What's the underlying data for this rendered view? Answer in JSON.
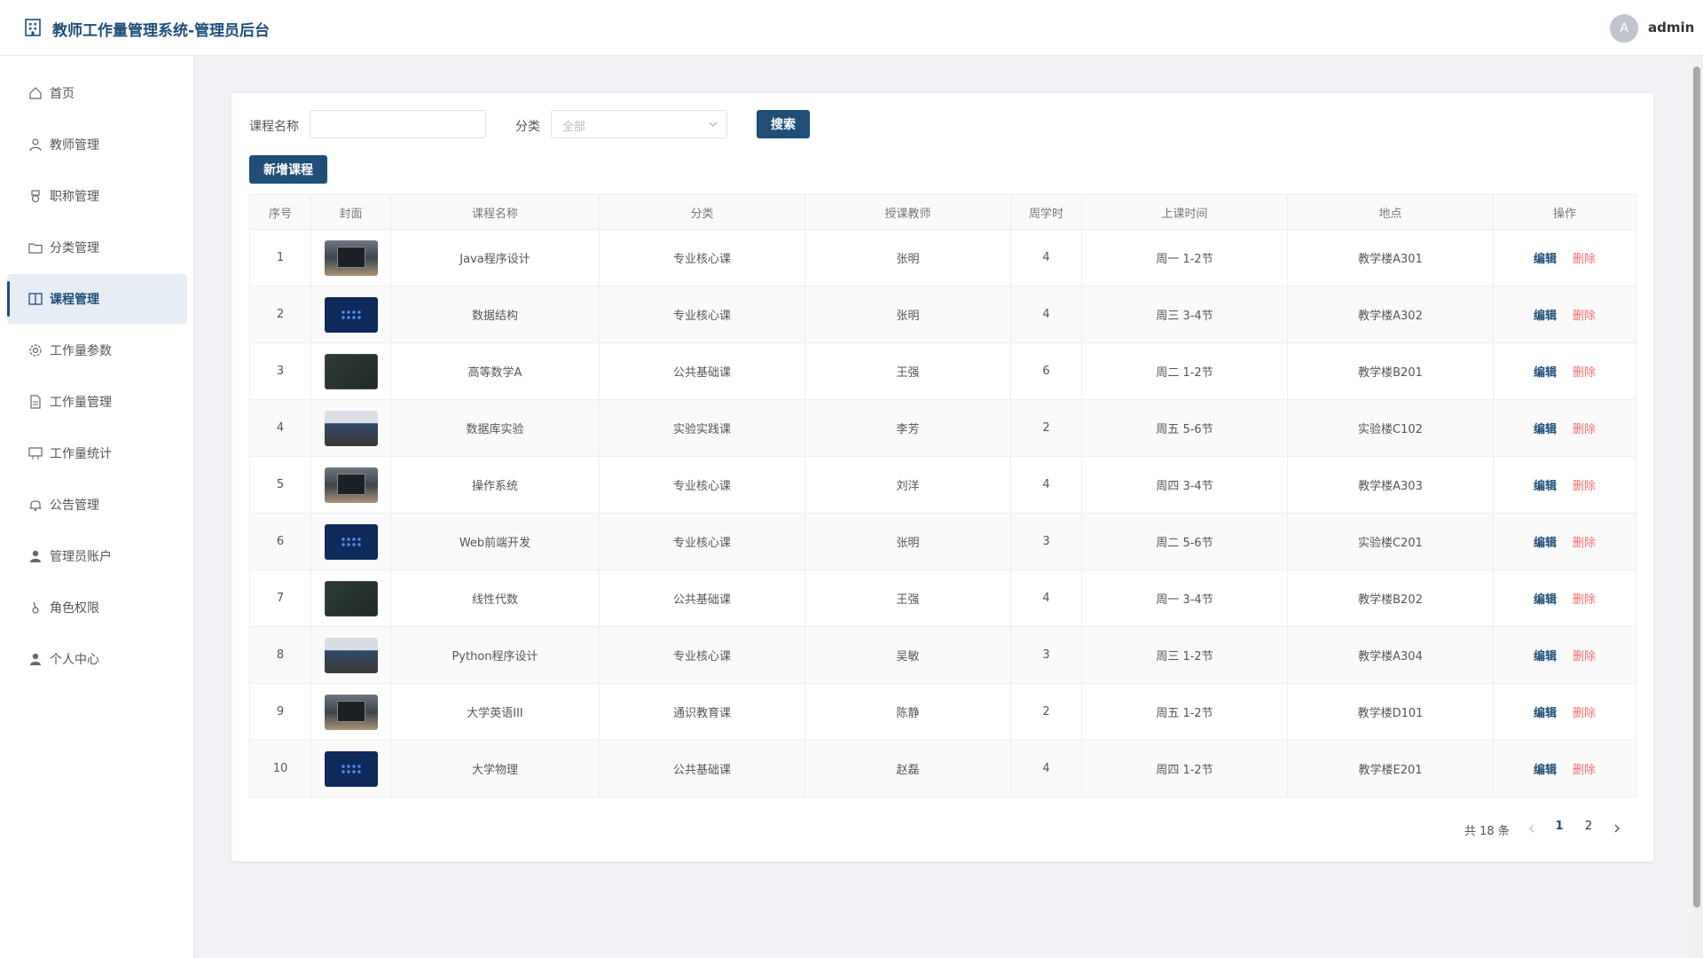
{
  "header": {
    "title": "教师工作量管理系统-管理员后台",
    "avatar_letter": "A",
    "username": "admin"
  },
  "sidebar": {
    "items": [
      {
        "label": "首页",
        "icon": "home-icon"
      },
      {
        "label": "教师管理",
        "icon": "user-icon"
      },
      {
        "label": "职称管理",
        "icon": "medal-icon"
      },
      {
        "label": "分类管理",
        "icon": "folder-icon"
      },
      {
        "label": "课程管理",
        "icon": "book-icon",
        "active": true
      },
      {
        "label": "工作量参数",
        "icon": "gear-icon"
      },
      {
        "label": "工作量管理",
        "icon": "document-icon"
      },
      {
        "label": "工作量统计",
        "icon": "chart-icon"
      },
      {
        "label": "公告管理",
        "icon": "bell-icon"
      },
      {
        "label": "管理员账户",
        "icon": "user-filled-icon"
      },
      {
        "label": "角色权限",
        "icon": "key-icon"
      },
      {
        "label": "个人中心",
        "icon": "user-filled-icon"
      }
    ]
  },
  "search": {
    "course_label": "课程名称",
    "course_value": "",
    "category_label": "分类",
    "category_placeholder": "全部",
    "search_button": "搜索",
    "add_button": "新增课程"
  },
  "table": {
    "headers": [
      "序号",
      "封面",
      "课程名称",
      "分类",
      "授课教师",
      "周学时",
      "上课时间",
      "地点",
      "操作"
    ],
    "edit_label": "编辑",
    "delete_label": "删除",
    "rows": [
      {
        "no": "1",
        "cover": "laptop",
        "name": "Java程序设计",
        "category": "专业核心课",
        "teacher": "张明",
        "hours": "4",
        "time": "周一 1-2节",
        "place": "教学楼A301"
      },
      {
        "no": "2",
        "cover": "dots",
        "name": "数据结构",
        "category": "专业核心课",
        "teacher": "张明",
        "hours": "4",
        "time": "周三 3-4节",
        "place": "教学楼A302"
      },
      {
        "no": "3",
        "cover": "board",
        "name": "高等数学A",
        "category": "公共基础课",
        "teacher": "王强",
        "hours": "6",
        "time": "周二 1-2节",
        "place": "教学楼B201"
      },
      {
        "no": "4",
        "cover": "photo",
        "name": "数据库实验",
        "category": "实验实践课",
        "teacher": "李芳",
        "hours": "2",
        "time": "周五 5-6节",
        "place": "实验楼C102"
      },
      {
        "no": "5",
        "cover": "laptop",
        "name": "操作系统",
        "category": "专业核心课",
        "teacher": "刘洋",
        "hours": "4",
        "time": "周四 3-4节",
        "place": "教学楼A303"
      },
      {
        "no": "6",
        "cover": "dots",
        "name": "Web前端开发",
        "category": "专业核心课",
        "teacher": "张明",
        "hours": "3",
        "time": "周二 5-6节",
        "place": "实验楼C201"
      },
      {
        "no": "7",
        "cover": "board",
        "name": "线性代数",
        "category": "公共基础课",
        "teacher": "王强",
        "hours": "4",
        "time": "周一 3-4节",
        "place": "教学楼B202"
      },
      {
        "no": "8",
        "cover": "photo",
        "name": "Python程序设计",
        "category": "专业核心课",
        "teacher": "吴敏",
        "hours": "3",
        "time": "周三 1-2节",
        "place": "教学楼A304"
      },
      {
        "no": "9",
        "cover": "laptop",
        "name": "大学英语III",
        "category": "通识教育课",
        "teacher": "陈静",
        "hours": "2",
        "time": "周五 1-2节",
        "place": "教学楼D101"
      },
      {
        "no": "10",
        "cover": "dots",
        "name": "大学物理",
        "category": "公共基础课",
        "teacher": "赵磊",
        "hours": "4",
        "time": "周四 1-2节",
        "place": "教学楼E201"
      }
    ]
  },
  "pagination": {
    "total_text": "共 18 条",
    "pages": [
      "1",
      "2"
    ],
    "current": "1"
  },
  "colors": {
    "primary": "#1f4e79",
    "danger": "#f56c6c"
  }
}
